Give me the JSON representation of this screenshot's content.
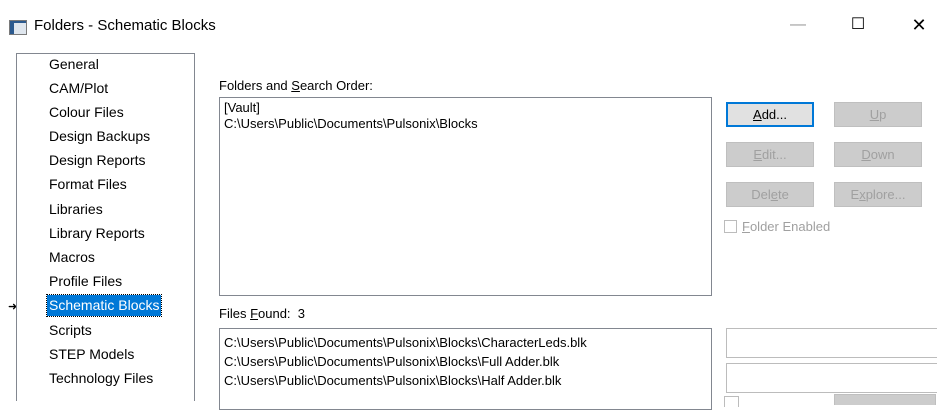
{
  "window": {
    "title": "Folders - Schematic Blocks",
    "minimize_glyph": "—",
    "maximize_glyph": "☐",
    "close_glyph": "✕"
  },
  "sidebar": {
    "items": [
      {
        "label": "General"
      },
      {
        "label": "CAM/Plot"
      },
      {
        "label": "Colour Files"
      },
      {
        "label": "Design Backups"
      },
      {
        "label": "Design Reports"
      },
      {
        "label": "Format Files"
      },
      {
        "label": "Libraries"
      },
      {
        "label": "Library Reports"
      },
      {
        "label": "Macros"
      },
      {
        "label": "Profile Files"
      },
      {
        "label": "Schematic Blocks"
      },
      {
        "label": "Scripts"
      },
      {
        "label": "STEP Models"
      },
      {
        "label": "Technology Files"
      }
    ],
    "selected_index": 10,
    "selected_marker": "➜"
  },
  "folders": {
    "label_pre": "Folders and ",
    "label_key": "S",
    "label_post": "earch Order:",
    "items": [
      "[Vault]",
      "C:\\Users\\Public\\Documents\\Pulsonix\\Blocks"
    ]
  },
  "buttons": {
    "add": {
      "pre": "",
      "key": "A",
      "post": "dd..."
    },
    "up": {
      "pre": "",
      "key": "U",
      "post": "p"
    },
    "edit": {
      "pre": "",
      "key": "E",
      "post": "dit..."
    },
    "down": {
      "pre": "",
      "key": "D",
      "post": "own"
    },
    "delete": {
      "pre": "Del",
      "key": "e",
      "post": "te"
    },
    "explore": {
      "pre": "E",
      "key": "x",
      "post": "plore..."
    }
  },
  "folder_enabled": {
    "pre": "",
    "key": "F",
    "post": "older Enabled",
    "checked": false
  },
  "files": {
    "label_pre": "Files ",
    "label_key": "F",
    "label_post": "ound:",
    "count": "3",
    "items": [
      "C:\\Users\\Public\\Documents\\Pulsonix\\Blocks\\CharacterLeds.blk",
      "C:\\Users\\Public\\Documents\\Pulsonix\\Blocks\\Full Adder.blk",
      "C:\\Users\\Public\\Documents\\Pulsonix\\Blocks\\Half Adder.blk"
    ]
  }
}
